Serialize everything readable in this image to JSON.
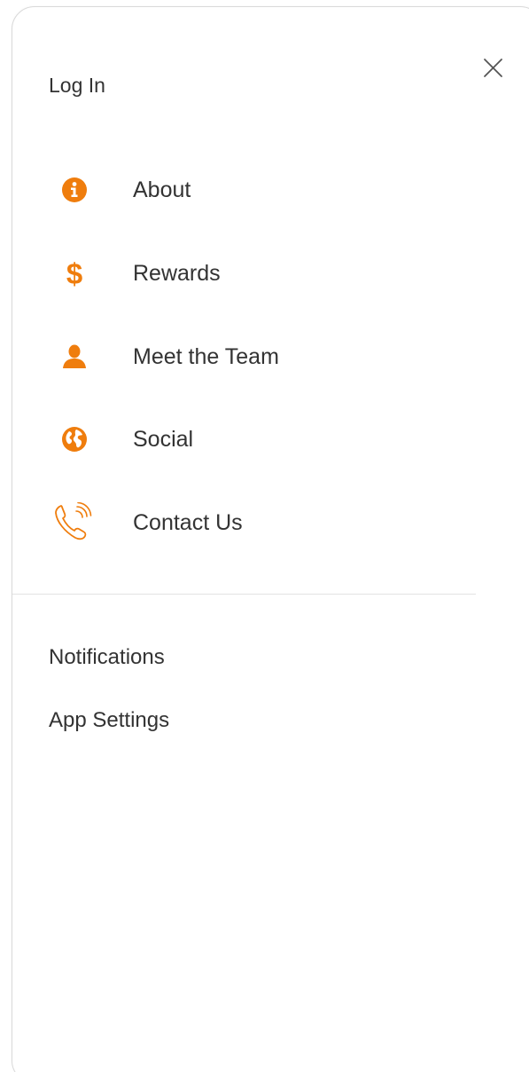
{
  "drawer": {
    "login_label": "Log In",
    "close_icon": "close-icon",
    "accent_color": "#ef7d0d",
    "menu_items": [
      {
        "label": "About",
        "icon": "info-circle-icon"
      },
      {
        "label": "Rewards",
        "icon": "dollar-icon"
      },
      {
        "label": "Meet the Team",
        "icon": "person-icon"
      },
      {
        "label": "Social",
        "icon": "globe-icon"
      },
      {
        "label": "Contact Us",
        "icon": "phone-icon"
      }
    ],
    "bottom_links": [
      {
        "label": "Notifications"
      },
      {
        "label": "App Settings"
      }
    ]
  }
}
